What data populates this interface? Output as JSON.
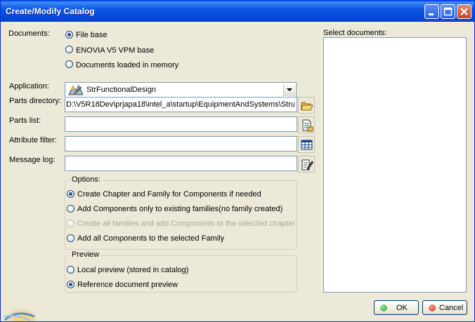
{
  "window": {
    "title": "Create/Modify Catalog"
  },
  "documents": {
    "label": "Documents:",
    "options": [
      {
        "label": "File base",
        "selected": true
      },
      {
        "label": "ENOVIA V5 VPM base",
        "selected": false
      },
      {
        "label": "Documents loaded in memory",
        "selected": false
      }
    ]
  },
  "fields": {
    "application_label": "Application:",
    "application_value": "StrFunctionalDesign",
    "parts_directory_label": "Parts directory:",
    "parts_directory_value": "D:\\V5R18Dev\\prjapa18\\intel_a\\startup\\EquipmentAndSystems\\Stru",
    "parts_list_label": "Parts list:",
    "parts_list_value": "",
    "attribute_filter_label": "Attribute filter:",
    "attribute_filter_value": "",
    "message_log_label": "Message log:",
    "message_log_value": ""
  },
  "options_group": {
    "legend": "Options:",
    "options": [
      {
        "label": "Create Chapter and Family for Components if needed",
        "selected": true,
        "enabled": true
      },
      {
        "label": "Add Components only to existing families(no family created)",
        "selected": false,
        "enabled": true
      },
      {
        "label": "Create all families and add Components to the selected chapter",
        "selected": false,
        "enabled": false
      },
      {
        "label": "Add all Components to the selected Family",
        "selected": false,
        "enabled": true
      }
    ]
  },
  "preview_group": {
    "legend": "Preview",
    "options": [
      {
        "label": "Local preview (stored in catalog)",
        "selected": false
      },
      {
        "label": "Reference document preview",
        "selected": true
      }
    ]
  },
  "select_documents": {
    "label": "Select documents:"
  },
  "buttons": {
    "ok": "OK",
    "cancel": "Cancel"
  },
  "colors": {
    "title_bar": "#0a56e6",
    "dialog_bg": "#ece9d8",
    "ok_dot": "#2fa42f",
    "cancel_dot": "#d42a1a"
  }
}
